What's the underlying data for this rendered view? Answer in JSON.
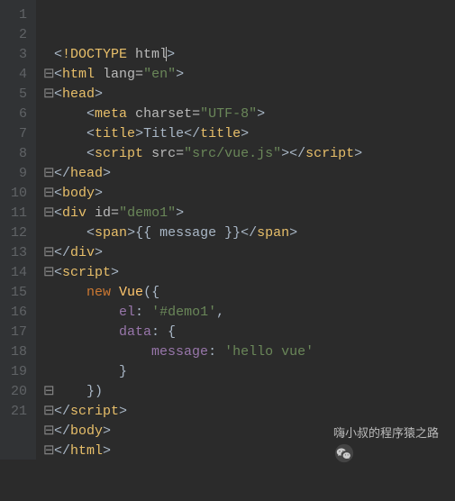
{
  "code": {
    "lines": [
      {
        "num": "1",
        "fold": " ",
        "indent": "",
        "tokens": [
          [
            "punct",
            "<"
          ],
          [
            "tag",
            "!DOCTYPE "
          ],
          [
            "attr",
            "html"
          ],
          [
            "punct",
            ">"
          ]
        ]
      },
      {
        "num": "2",
        "fold": "⊟",
        "indent": "",
        "tokens": [
          [
            "punct",
            "<"
          ],
          [
            "tag",
            "html "
          ],
          [
            "attr",
            "lang="
          ],
          [
            "str",
            "\"en\""
          ],
          [
            "punct",
            ">"
          ]
        ]
      },
      {
        "num": "3",
        "fold": "⊟",
        "indent": "",
        "tokens": [
          [
            "punct",
            "<"
          ],
          [
            "tag",
            "head"
          ],
          [
            "punct",
            ">"
          ]
        ]
      },
      {
        "num": "4",
        "fold": " ",
        "indent": "    ",
        "tokens": [
          [
            "punct",
            "<"
          ],
          [
            "tag",
            "meta "
          ],
          [
            "attr",
            "charset="
          ],
          [
            "str",
            "\"UTF-8\""
          ],
          [
            "punct",
            ">"
          ]
        ]
      },
      {
        "num": "5",
        "fold": " ",
        "indent": "    ",
        "tokens": [
          [
            "punct",
            "<"
          ],
          [
            "tag",
            "title"
          ],
          [
            "punct",
            ">"
          ],
          [
            "plain",
            "Title"
          ],
          [
            "punct",
            "</"
          ],
          [
            "tag",
            "title"
          ],
          [
            "punct",
            ">"
          ]
        ]
      },
      {
        "num": "6",
        "fold": " ",
        "indent": "    ",
        "tokens": [
          [
            "punct",
            "<"
          ],
          [
            "tag",
            "script "
          ],
          [
            "attr",
            "src="
          ],
          [
            "str",
            "\"src/vue.js\""
          ],
          [
            "punct",
            "></"
          ],
          [
            "tag",
            "script"
          ],
          [
            "punct",
            ">"
          ]
        ]
      },
      {
        "num": "7",
        "fold": "⊟",
        "indent": "",
        "tokens": [
          [
            "punct",
            "</"
          ],
          [
            "tag",
            "head"
          ],
          [
            "punct",
            ">"
          ]
        ]
      },
      {
        "num": "8",
        "fold": "⊟",
        "indent": "",
        "tokens": [
          [
            "punct",
            "<"
          ],
          [
            "tag",
            "body"
          ],
          [
            "punct",
            ">"
          ]
        ]
      },
      {
        "num": "9",
        "fold": "⊟",
        "indent": "",
        "tokens": [
          [
            "punct",
            "<"
          ],
          [
            "tag",
            "div "
          ],
          [
            "attr",
            "id="
          ],
          [
            "str",
            "\"demo1\""
          ],
          [
            "punct",
            ">"
          ]
        ]
      },
      {
        "num": "10",
        "fold": " ",
        "indent": "    ",
        "tokens": [
          [
            "punct",
            "<"
          ],
          [
            "tag",
            "span"
          ],
          [
            "punct",
            ">"
          ],
          [
            "plain",
            "{{ message }}"
          ],
          [
            "punct",
            "</"
          ],
          [
            "tag",
            "span"
          ],
          [
            "punct",
            ">"
          ]
        ]
      },
      {
        "num": "11",
        "fold": "⊟",
        "indent": "",
        "tokens": [
          [
            "punct",
            "</"
          ],
          [
            "tag",
            "div"
          ],
          [
            "punct",
            ">"
          ]
        ]
      },
      {
        "num": "12",
        "fold": "⊟",
        "indent": "",
        "tokens": [
          [
            "punct",
            "<"
          ],
          [
            "tag",
            "script"
          ],
          [
            "punct",
            ">"
          ]
        ]
      },
      {
        "num": "13",
        "fold": " ",
        "indent": "    ",
        "tokens": [
          [
            "kw",
            "new "
          ],
          [
            "obj",
            "Vue"
          ],
          [
            "punct",
            "({"
          ]
        ]
      },
      {
        "num": "14",
        "fold": " ",
        "indent": "        ",
        "tokens": [
          [
            "prop",
            "el"
          ],
          [
            "punct",
            ": "
          ],
          [
            "str",
            "'#demo1'"
          ],
          [
            "punct",
            ","
          ]
        ]
      },
      {
        "num": "15",
        "fold": " ",
        "indent": "        ",
        "tokens": [
          [
            "prop",
            "data"
          ],
          [
            "punct",
            ": {"
          ]
        ]
      },
      {
        "num": "16",
        "fold": " ",
        "indent": "            ",
        "tokens": [
          [
            "prop",
            "message"
          ],
          [
            "punct",
            ": "
          ],
          [
            "str",
            "'hello vue'"
          ]
        ]
      },
      {
        "num": "17",
        "fold": " ",
        "indent": "        ",
        "tokens": [
          [
            "punct",
            "}"
          ]
        ]
      },
      {
        "num": "18",
        "fold": "⊟",
        "indent": "    ",
        "tokens": [
          [
            "punct",
            "})"
          ]
        ]
      },
      {
        "num": "19",
        "fold": "⊟",
        "indent": "",
        "tokens": [
          [
            "punct",
            "</"
          ],
          [
            "tag",
            "script"
          ],
          [
            "punct",
            ">"
          ]
        ]
      },
      {
        "num": "20",
        "fold": "⊟",
        "indent": "",
        "tokens": [
          [
            "punct",
            "</"
          ],
          [
            "tag",
            "body"
          ],
          [
            "punct",
            ">"
          ]
        ]
      },
      {
        "num": "21",
        "fold": "⊟",
        "indent": "",
        "tokens": [
          [
            "punct",
            "</"
          ],
          [
            "tag",
            "html"
          ],
          [
            "punct",
            ">"
          ]
        ]
      }
    ]
  },
  "watermark": {
    "text": "嗨小叔的程序猿之路"
  }
}
